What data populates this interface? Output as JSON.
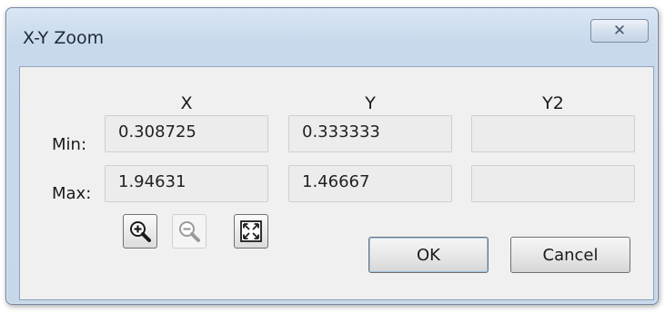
{
  "window": {
    "title": "X-Y Zoom",
    "close_glyph": "✕"
  },
  "columns": [
    "X",
    "Y",
    "Y2"
  ],
  "rows": [
    {
      "label": "Min:",
      "values": [
        "0.308725",
        "0.333333",
        ""
      ]
    },
    {
      "label": "Max:",
      "values": [
        "1.94631",
        "1.46667",
        ""
      ]
    }
  ],
  "toolbar": {
    "zoom_in_icon": "magnifier-plus-icon",
    "zoom_out_icon": "magnifier-minus-icon",
    "fit_icon": "zoom-fit-icon"
  },
  "buttons": {
    "ok_label": "OK",
    "cancel_label": "Cancel"
  }
}
